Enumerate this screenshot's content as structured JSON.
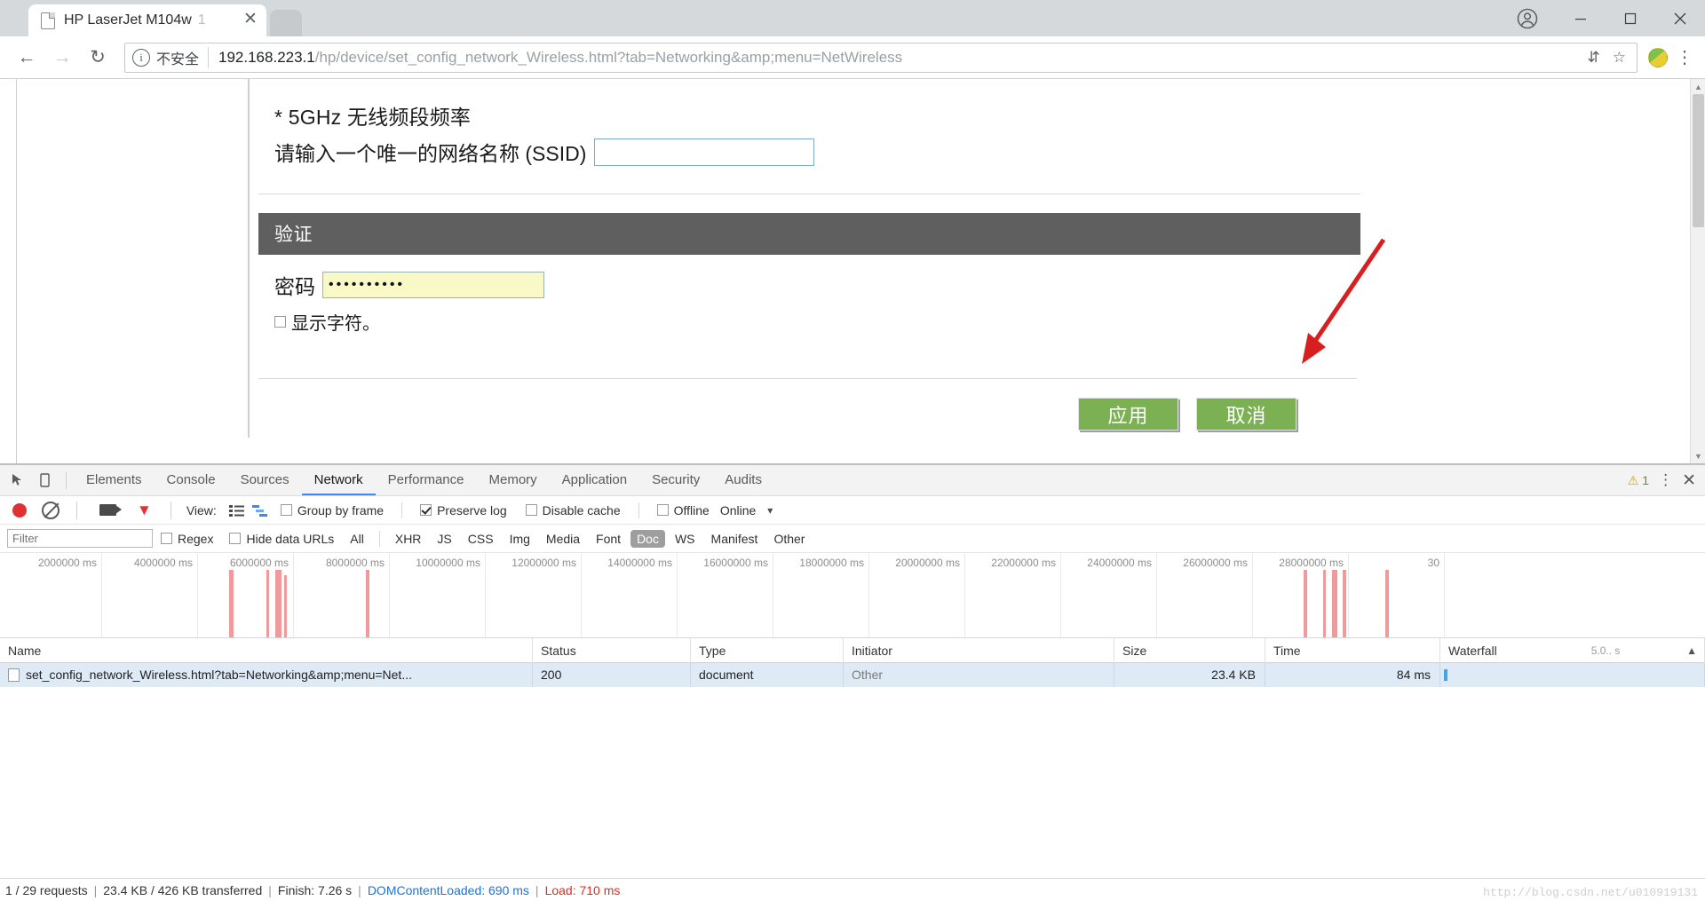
{
  "browser": {
    "tab": {
      "title": "HP LaserJet M104w",
      "title_overflow": "1",
      "close_label": "✕"
    },
    "window_controls": {
      "minimize": "─",
      "maximize": "□",
      "close": "✕"
    },
    "nav": {
      "back": "←",
      "forward": "→",
      "reload": "↻"
    },
    "omnibox": {
      "security_glyph": "i",
      "security_label": "不安全",
      "url_host": "192.168.223.1",
      "url_path": "/hp/device/set_config_network_Wireless.html?tab=Networking&amp;menu=NetWireless",
      "translate_glyph": "⇵",
      "bookmark_glyph": "☆"
    },
    "menu_glyph": "⋮"
  },
  "page": {
    "freq_label": "* 5GHz 无线频段频率",
    "ssid_label": "请输入一个唯一的网络名称 (SSID)",
    "ssid_value": "",
    "section_auth": "验证",
    "password_label": "密码",
    "password_value": "••••••••••",
    "show_chars_label": "显示字符。",
    "apply_label": "应用",
    "cancel_label": "取消",
    "accent_green": "#7cb153",
    "header_gray": "#5f5f5f"
  },
  "devtools": {
    "tabs": [
      {
        "label": "Elements",
        "active": false
      },
      {
        "label": "Console",
        "active": false
      },
      {
        "label": "Sources",
        "active": false
      },
      {
        "label": "Network",
        "active": true
      },
      {
        "label": "Performance",
        "active": false
      },
      {
        "label": "Memory",
        "active": false
      },
      {
        "label": "Application",
        "active": false
      },
      {
        "label": "Security",
        "active": false
      },
      {
        "label": "Audits",
        "active": false
      }
    ],
    "warning_count": "1",
    "warning_glyph": "⚠",
    "more_glyph": "⋮",
    "close_glyph": "✕",
    "toolbar": {
      "view_label": "View:",
      "group_by_frame": "Group by frame",
      "group_by_frame_checked": false,
      "preserve_log": "Preserve log",
      "preserve_log_checked": true,
      "disable_cache": "Disable cache",
      "disable_cache_checked": false,
      "offline": "Offline",
      "offline_checked": false,
      "online": "Online",
      "caret": "▾"
    },
    "filter": {
      "placeholder": "Filter",
      "value": "",
      "regex_label": "Regex",
      "regex_checked": false,
      "hide_data_urls_label": "Hide data URLs",
      "hide_data_urls_checked": false,
      "types": [
        {
          "label": "All",
          "selected": false
        },
        {
          "label": "XHR",
          "selected": false
        },
        {
          "label": "JS",
          "selected": false
        },
        {
          "label": "CSS",
          "selected": false
        },
        {
          "label": "Img",
          "selected": false
        },
        {
          "label": "Media",
          "selected": false
        },
        {
          "label": "Font",
          "selected": false
        },
        {
          "label": "Doc",
          "selected": true
        },
        {
          "label": "WS",
          "selected": false
        },
        {
          "label": "Manifest",
          "selected": false
        },
        {
          "label": "Other",
          "selected": false
        }
      ]
    },
    "overview_ticks": [
      "2000000 ms",
      "4000000 ms",
      "6000000 ms",
      "8000000 ms",
      "10000000 ms",
      "12000000 ms",
      "14000000 ms",
      "16000000 ms",
      "18000000 ms",
      "20000000 ms",
      "22000000 ms",
      "24000000 ms",
      "26000000 ms",
      "28000000 ms",
      "30"
    ],
    "table": {
      "columns": [
        "Name",
        "Status",
        "Type",
        "Initiator",
        "Size",
        "Time",
        "Waterfall"
      ],
      "waterfall_scale": "5.0.. s",
      "sort_caret": "▲",
      "rows": [
        {
          "name": "set_config_network_Wireless.html?tab=Networking&amp;menu=Net...",
          "status": "200",
          "type": "document",
          "initiator": "Other",
          "size": "23.4 KB",
          "time": "84 ms"
        }
      ]
    },
    "status": {
      "requests": "1 / 29 requests",
      "transferred": "23.4 KB / 426 KB transferred",
      "finish": "Finish: 7.26 s",
      "dom_content_loaded": "DOMContentLoaded: 690 ms",
      "load": "Load: 710 ms",
      "separator": "|"
    },
    "watermark": "http://blog.csdn.net/u010919131"
  }
}
